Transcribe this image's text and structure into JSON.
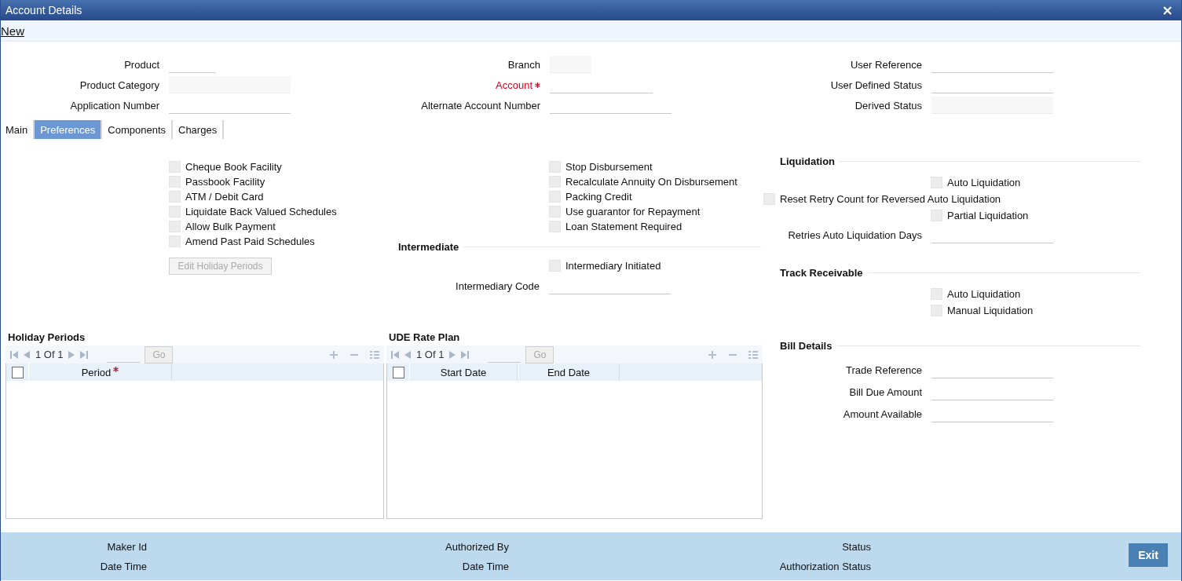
{
  "window": {
    "title": "Account Details"
  },
  "toolbar": {
    "links": [
      "New"
    ]
  },
  "header_fields": [
    [
      {
        "label": "Product",
        "required": false,
        "disabled": false
      },
      {
        "label": "Product Category",
        "required": false,
        "disabled": true
      },
      {
        "label": "Application Number",
        "required": false,
        "disabled": false
      }
    ],
    [
      {
        "label": "Branch",
        "required": false,
        "disabled": true
      },
      {
        "label": "Account",
        "required": true,
        "disabled": false
      },
      {
        "label": "Alternate Account Number",
        "required": false,
        "disabled": false
      }
    ],
    [
      {
        "label": "User Reference",
        "required": false,
        "disabled": false
      },
      {
        "label": "User Defined Status",
        "required": false,
        "disabled": false
      },
      {
        "label": "Derived Status",
        "required": false,
        "disabled": true
      }
    ]
  ],
  "tabs": [
    {
      "label": "Main",
      "selected": false
    },
    {
      "label": "Preferences",
      "selected": true
    },
    {
      "label": "Components",
      "selected": false
    },
    {
      "label": "Charges",
      "selected": false
    }
  ],
  "left_options": [
    {
      "label": "Cheque Book Facility",
      "checked": false
    },
    {
      "label": "Passbook Facility",
      "checked": false
    },
    {
      "label": "ATM / Debit Card",
      "checked": false
    },
    {
      "label": "Liquidate Back Valued Schedules",
      "checked": false
    },
    {
      "label": "Allow Bulk Payment",
      "checked": false
    },
    {
      "label": "Amend Past Paid Schedules",
      "checked": false
    }
  ],
  "edit_button": {
    "label": "Edit Holiday Periods",
    "disabled": true
  },
  "middle_options": [
    {
      "label": "Stop Disbursement",
      "checked": false
    },
    {
      "label": "Recalculate Annuity On Disbursement",
      "checked": false
    },
    {
      "label": "Packing Credit",
      "checked": false
    },
    {
      "label": "Use guarantor for Repayment",
      "checked": false
    },
    {
      "label": "Loan Statement Required",
      "checked": false
    }
  ],
  "intermediate": {
    "title": "Intermediate",
    "items": [
      {
        "kind": "checkbox",
        "label": "Intermediary Initiated",
        "checked": false
      },
      {
        "kind": "field",
        "label": "Intermediary Code"
      }
    ]
  },
  "right_sections": [
    {
      "title": "Liquidation",
      "items": [
        {
          "kind": "checkbox",
          "label": "Auto Liquidation",
          "checked": false
        },
        {
          "kind": "wide_checkbox",
          "label": "Reset Retry Count for Reversed Auto Liquidation",
          "checked": false
        },
        {
          "kind": "checkbox",
          "label": "Partial Liquidation",
          "checked": false
        },
        {
          "kind": "field",
          "label": "Retries Auto Liquidation Days"
        }
      ]
    },
    {
      "title": "Track Receivable",
      "items": [
        {
          "kind": "checkbox",
          "label": "Auto Liquidation",
          "checked": false
        },
        {
          "kind": "checkbox",
          "label": "Manual Liquidation",
          "checked": false
        }
      ]
    },
    {
      "title": "Bill Details",
      "items": [
        {
          "kind": "field",
          "label": "Trade Reference"
        },
        {
          "kind": "field",
          "label": "Bill Due Amount"
        },
        {
          "kind": "field",
          "label": "Amount Available"
        }
      ]
    }
  ],
  "grids": [
    {
      "title": "Holiday Periods",
      "select_all_checked": false,
      "pager": "1 Of 1",
      "go": {
        "label": "Go",
        "disabled": true
      },
      "columns": [
        {
          "label": "Period",
          "required": true
        }
      ]
    },
    {
      "title": "UDE Rate Plan",
      "select_all_checked": false,
      "pager": "1 Of 1",
      "go": {
        "label": "Go",
        "disabled": true
      },
      "columns": [
        {
          "label": "Start Date",
          "required": false
        },
        {
          "label": "End Date",
          "required": false
        }
      ]
    }
  ],
  "footer": {
    "fields": [
      [
        "Maker Id",
        "Date Time"
      ],
      [
        "Authorized By",
        "Date Time"
      ],
      [
        "Status",
        "Authorization Status"
      ]
    ],
    "exit": "Exit"
  }
}
